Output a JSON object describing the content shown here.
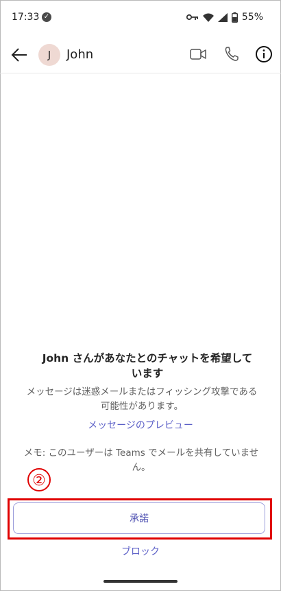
{
  "status_bar": {
    "time": "17:33",
    "battery_percent": "55%"
  },
  "header": {
    "avatar_initial": "J",
    "contact_name": "John"
  },
  "request": {
    "title_line1": "John さんがあなたとのチャットを希望して",
    "title_line2": "います",
    "description_line1": "メッセージは迷惑メールまたはフィッシング攻撃である",
    "description_line2": "可能性があります。",
    "preview_link": "メッセージのプレビュー",
    "memo_line1": "メモ: このユーザーは Teams でメールを共有していませ",
    "memo_line2": "ん。"
  },
  "annotation": {
    "number": "②"
  },
  "actions": {
    "accept_label": "承諾",
    "block_label": "ブロック"
  },
  "colors": {
    "accent": "#5b5fc7",
    "highlight": "#e00000",
    "avatar_bg": "#efd9d3"
  }
}
